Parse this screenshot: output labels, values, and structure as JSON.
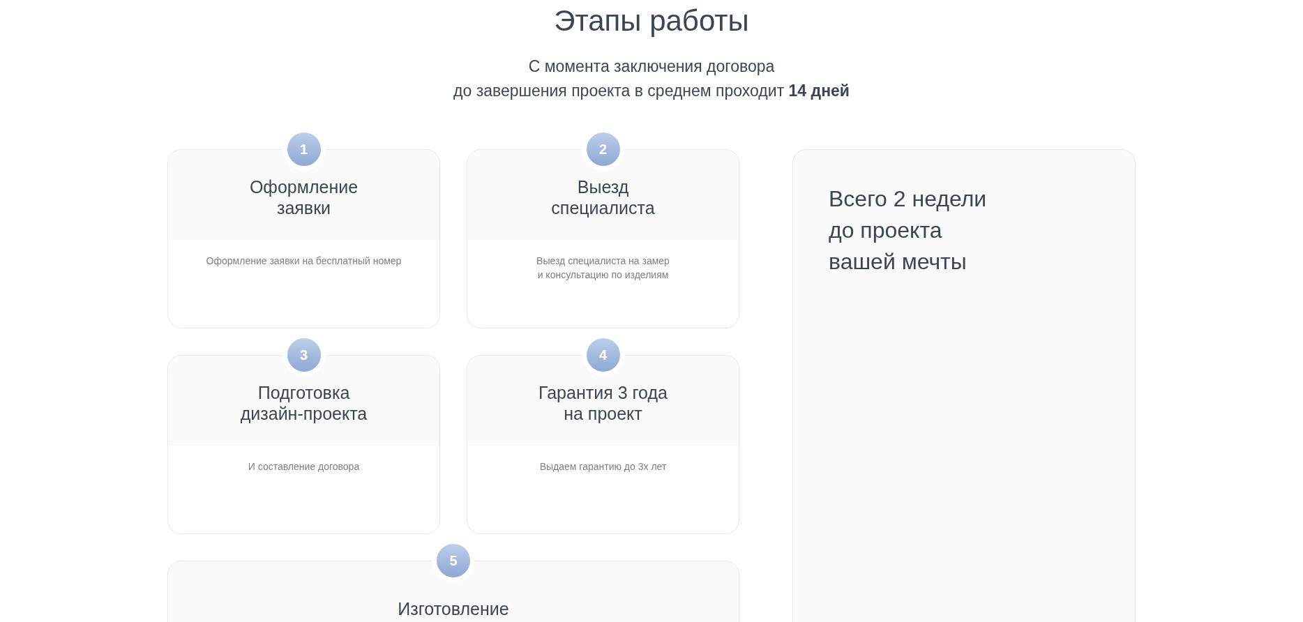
{
  "heading": "Этапы работы",
  "subtitle": [
    "С момента заключения договора",
    "до завершения проекта в среднем проходит **14 дней**"
  ],
  "steps": [
    {
      "number": "1",
      "title": [
        "Оформление",
        "заявки"
      ],
      "description": [
        "Оформление заявки на бесплатный номер"
      ]
    },
    {
      "number": "2",
      "title": [
        "Выезд",
        "специалиста"
      ],
      "description": [
        "Выезд специалиста на замер",
        "и консультацию по изделиям"
      ]
    },
    {
      "number": "3",
      "title": [
        "Подготовка",
        "дизайн-проекта"
      ],
      "description": [
        "И составление договора"
      ]
    },
    {
      "number": "4",
      "title": [
        "Гарантия 3 года",
        "на проект"
      ],
      "description": [
        "Выдаем гарантию до 3х лет"
      ]
    },
    {
      "number": "5",
      "title": [
        "Изготовление"
      ]
    }
  ],
  "summary": {
    "text": [
      "Всего 2 недели",
      "до проекта",
      "вашей мечты"
    ]
  }
}
